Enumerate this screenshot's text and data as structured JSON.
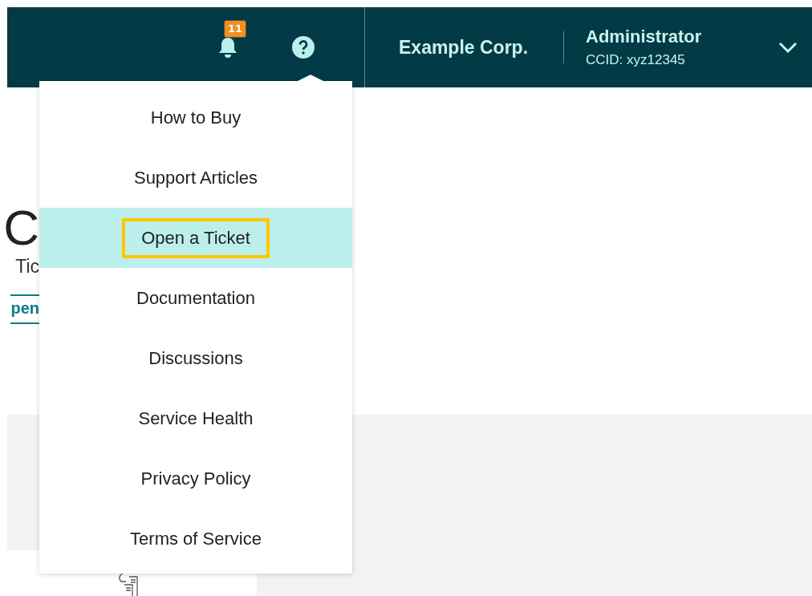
{
  "header": {
    "notifications": {
      "count": "11"
    },
    "organization": "Example Corp.",
    "user": {
      "name": "Administrator",
      "ccid": "CCID: xyz12345"
    }
  },
  "page": {
    "heading": "C",
    "subtitle": "Tic",
    "link": "pen"
  },
  "help_menu": {
    "items": [
      {
        "label": "How to Buy",
        "selected": false
      },
      {
        "label": "Support Articles",
        "selected": false
      },
      {
        "label": "Open a Ticket",
        "selected": true
      },
      {
        "label": "Documentation",
        "selected": false
      },
      {
        "label": "Discussions",
        "selected": false
      },
      {
        "label": "Service Health",
        "selected": false
      },
      {
        "label": "Privacy Policy",
        "selected": false
      },
      {
        "label": "Terms of Service",
        "selected": false
      }
    ]
  }
}
